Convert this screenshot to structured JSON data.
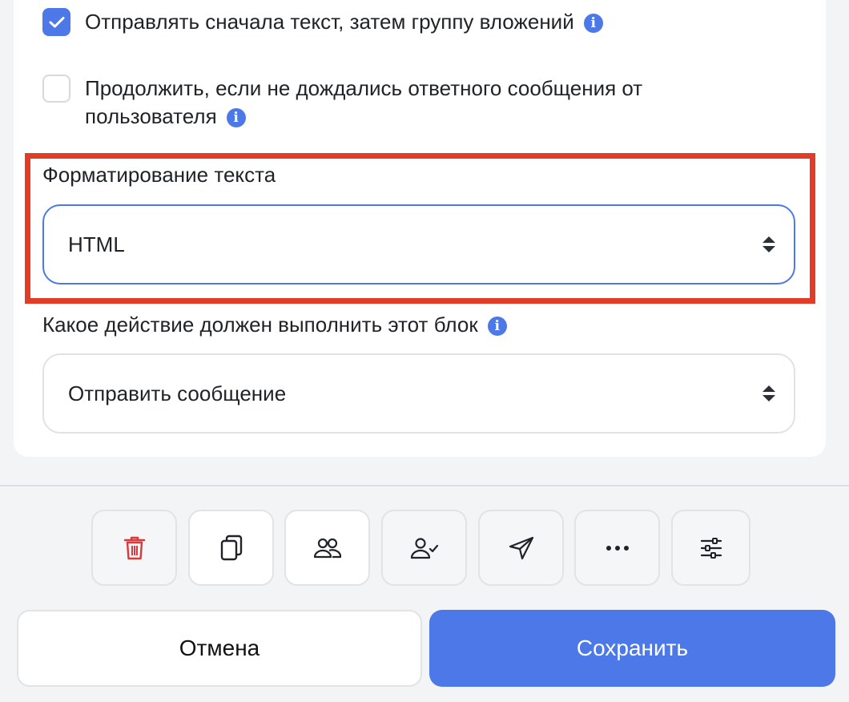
{
  "options": {
    "send_text_first": {
      "label": "Отправлять сначала текст, затем группу вложений",
      "checked": true
    },
    "continue_without_reply": {
      "label": "Продолжить, если не дождались ответного сообщения от пользователя",
      "checked": false
    }
  },
  "text_formatting": {
    "label": "Форматирование текста",
    "value": "HTML"
  },
  "block_action": {
    "label": "Какое действие должен выполнить этот блок",
    "value": "Отправить сообщение"
  },
  "toolbar": {
    "icons": [
      "trash-icon",
      "copy-icon",
      "users-icon",
      "user-check-icon",
      "send-icon",
      "more-icon",
      "sliders-icon"
    ]
  },
  "footer": {
    "cancel_label": "Отмена",
    "save_label": "Сохранить"
  },
  "colors": {
    "accent": "#4d78e8",
    "highlight": "#e23c27",
    "danger": "#d9393b"
  }
}
